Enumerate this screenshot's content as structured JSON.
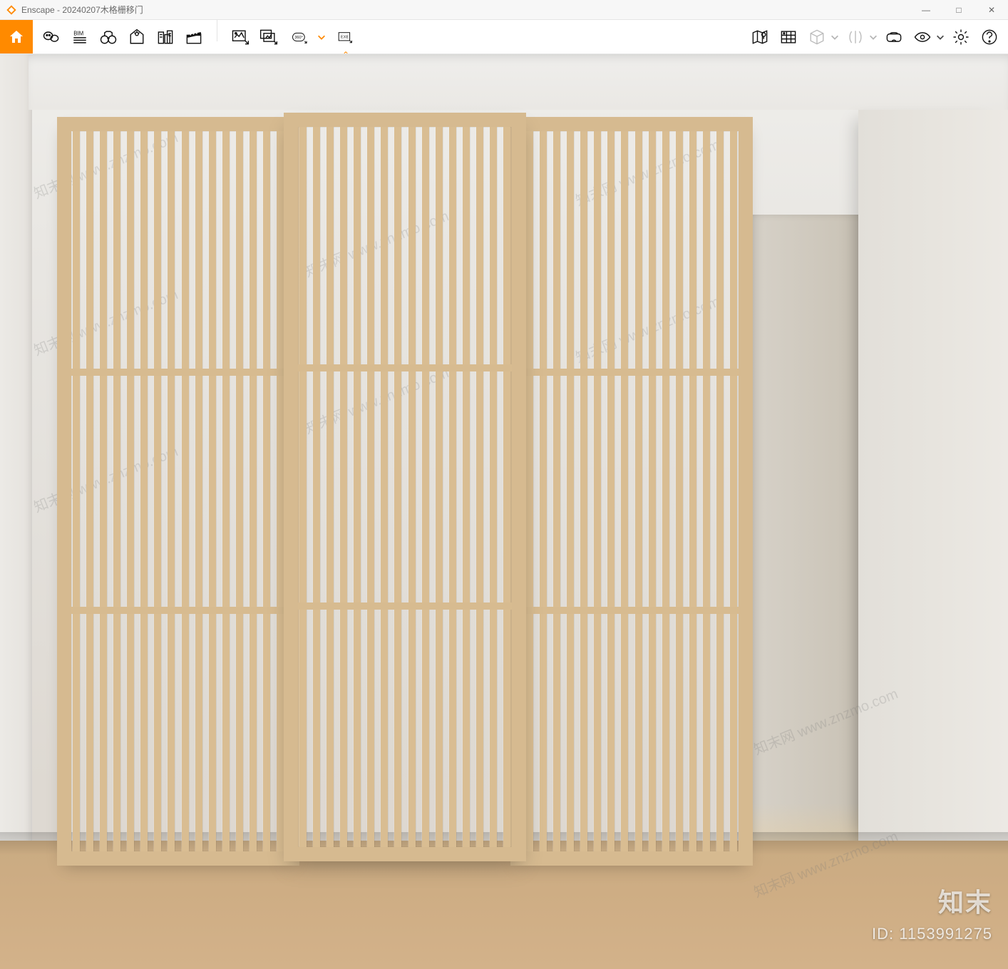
{
  "app": {
    "name": "Enscape",
    "document": "20240207木格栅移门",
    "title_separator": " - "
  },
  "window_controls": {
    "minimize": "—",
    "maximize": "□",
    "close": "✕"
  },
  "toolbar": {
    "home": "home-icon",
    "group1": [
      {
        "name": "issues-icon",
        "label": "Issues"
      },
      {
        "name": "bim-icon",
        "label": "BIM",
        "text": "BIM"
      },
      {
        "name": "binoculars-icon",
        "label": "Views"
      },
      {
        "name": "sun-study-icon",
        "label": "Sun Study"
      },
      {
        "name": "site-context-icon",
        "label": "Site Context"
      },
      {
        "name": "clapper-icon",
        "label": "Video"
      }
    ],
    "group2": [
      {
        "name": "screenshot-icon",
        "label": "Screenshot"
      },
      {
        "name": "batch-render-icon",
        "label": "Batch Render"
      },
      {
        "name": "pano-360-icon",
        "label": "360 Panorama",
        "text": "360°",
        "hasDropdown": true
      },
      {
        "name": "exe-export-icon",
        "label": "EXE Standalone",
        "text": "EXE",
        "hasCaretBelow": true
      }
    ],
    "group3": [
      {
        "name": "map-icon",
        "label": "Mini Map"
      },
      {
        "name": "asset-library-icon",
        "label": "Asset Library"
      },
      {
        "name": "cube-icon",
        "label": "White Mode",
        "disabled": true
      },
      {
        "name": "compare-icon",
        "label": "Compare",
        "disabled": true,
        "hasDropdown": true
      },
      {
        "name": "vr-headset-icon",
        "label": "VR"
      },
      {
        "name": "visibility-icon",
        "label": "Visual Settings",
        "hasDropdown": true
      },
      {
        "name": "settings-icon",
        "label": "Settings"
      },
      {
        "name": "help-icon",
        "label": "Help"
      }
    ]
  },
  "watermark": {
    "brand": "知末",
    "id_label": "ID: 1153991275",
    "diag": "知末网 www.znzmo.com"
  }
}
